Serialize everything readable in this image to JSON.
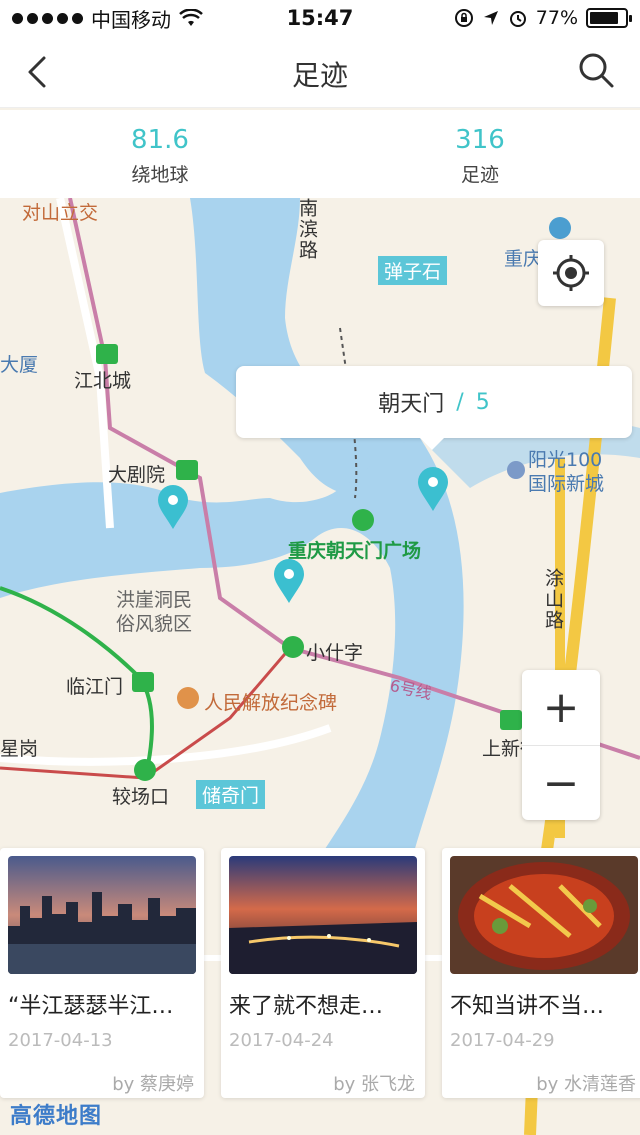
{
  "status_bar": {
    "carrier": "中国移动",
    "time": "15:47",
    "battery": "77%",
    "battery_level": 0.77,
    "icons": [
      "signal-dots",
      "wifi-icon",
      "orientation-lock-icon",
      "location-arrow-icon",
      "alarm-icon",
      "battery-icon"
    ]
  },
  "nav": {
    "title": "足迹",
    "back_icon": "chevron-left-icon",
    "search_icon": "search-icon"
  },
  "stats": [
    {
      "value": "81.6",
      "label": "绕地球"
    },
    {
      "value": "316",
      "label": "足迹"
    }
  ],
  "map": {
    "labels": {
      "duishan": "对山立交",
      "nanbin": "南滨路",
      "danzishi": "弹子石",
      "chongqing_short": "重庆",
      "dasha": "大厦",
      "jiangbeicheng": "江北城",
      "dajuyuan": "大剧院",
      "yangguang": "阳光100\n国际新城",
      "chaotianmen_square": "重庆朝天门广场",
      "hongyadong": "洪崖洞民\n俗风貌区",
      "xiaoshizi": "小什字",
      "linjiangmen": "临江门",
      "monument": "人民解放纪念碑",
      "line6": "6号线",
      "shangxinjie": "上新街",
      "xinggang": "星岗",
      "jiaochangkou": "较场口",
      "chuqimen": "储奇门",
      "tushan": "涂山路"
    },
    "callout": {
      "place": "朝天门",
      "separator": "/",
      "count": "5"
    },
    "location_icon": "crosshair-icon",
    "zoom_in": "+",
    "zoom_out": "−"
  },
  "cards": [
    {
      "title": "“半江瑟瑟半江…",
      "date": "2017-04-13",
      "author": "by 蔡庚婷",
      "image": "city-skyline-dusk"
    },
    {
      "title": "来了就不想走…",
      "date": "2017-04-24",
      "author": "by 张飞龙",
      "image": "city-night-lights"
    },
    {
      "title": "不知当讲不当…",
      "date": "2017-04-29",
      "author": "by 水清莲香",
      "image": "hotpot-food"
    }
  ],
  "logo": "高德地图",
  "colors": {
    "accent": "#40c4c9",
    "water": "#a9d3ee",
    "land": "#f6f1e7"
  }
}
